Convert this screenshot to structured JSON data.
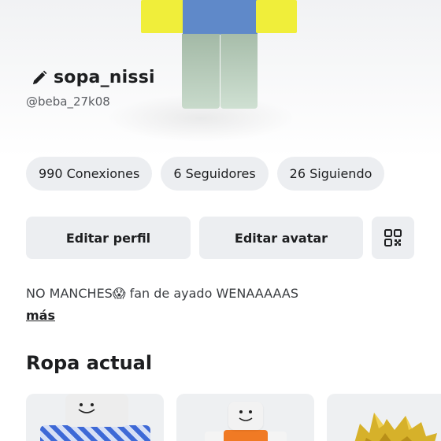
{
  "profile": {
    "display_name": "sopa_nissi",
    "username": "@beba_27k08",
    "bio": "NO MANCHES😱 fan de ayado WENAAAAAS",
    "more_label": "más"
  },
  "stats": [
    {
      "label": "990 Conexiones"
    },
    {
      "label": "6 Seguidores"
    },
    {
      "label": "26 Siguiendo"
    }
  ],
  "actions": {
    "edit_profile": "Editar perfil",
    "edit_avatar": "Editar avatar",
    "qr_icon": "qr-code-icon"
  },
  "outfit_section": {
    "title": "Ropa actual"
  },
  "icons": {
    "pencil": "pencil-icon",
    "qr": "qr-code-icon"
  },
  "colors": {
    "pill_bg": "#eceef1",
    "text_primary": "#1d1e20",
    "text_secondary": "#5b5e63",
    "avatar_arms": "#f0ee3a",
    "avatar_torso": "#5f89c9",
    "avatar_legs": "#a3b9a6"
  }
}
